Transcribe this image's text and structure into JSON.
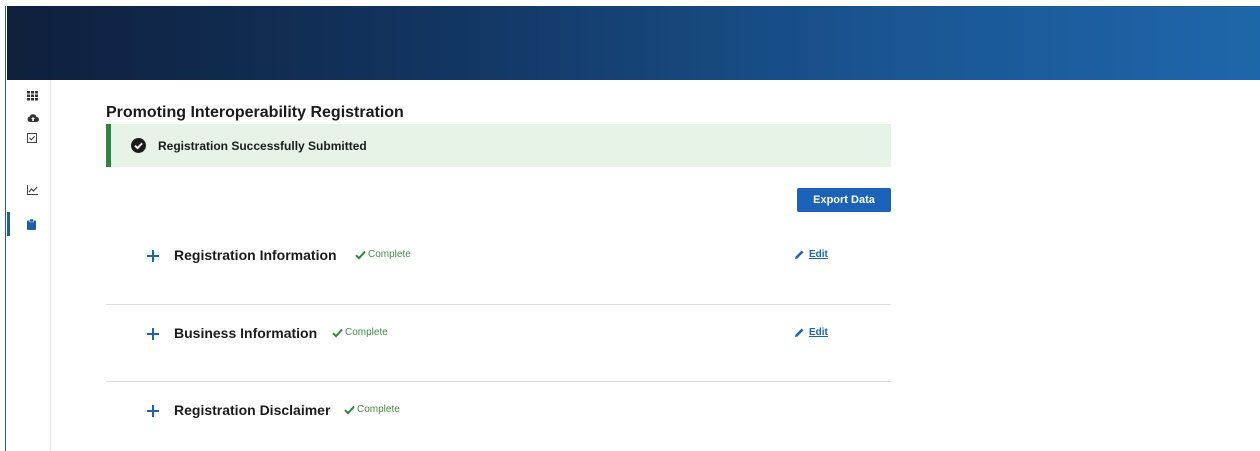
{
  "page": {
    "title": "Promoting Interoperability Registration"
  },
  "alert": {
    "type": "success",
    "message": "Registration Successfully Submitted",
    "icon": "check-circle-icon"
  },
  "actions": {
    "export_label": "Export Data"
  },
  "sidebar": {
    "items": [
      {
        "icon": "grid-icon",
        "active": false
      },
      {
        "icon": "cloud-upload-icon",
        "active": false
      },
      {
        "icon": "checkbox-icon",
        "active": false
      },
      {
        "icon": "chart-icon",
        "active": false
      },
      {
        "icon": "clipboard-icon",
        "active": true
      }
    ]
  },
  "sections": [
    {
      "title": "Registration Information",
      "status": "Complete",
      "edit_label": "Edit"
    },
    {
      "title": "Business Information",
      "status": "Complete",
      "edit_label": "Edit"
    },
    {
      "title": "Registration Disclaimer",
      "status": "Complete"
    }
  ],
  "colors": {
    "header_start": "#0f1f3c",
    "header_end": "#1e66ab",
    "primary": "#1a63b8",
    "success": "#2e8540",
    "success_bg": "#e6f3e6"
  }
}
